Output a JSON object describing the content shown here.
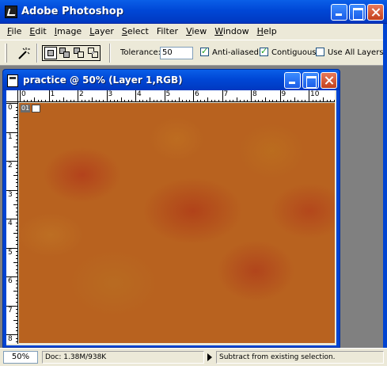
{
  "app": {
    "title": "Adobe Photoshop"
  },
  "menubar": {
    "items": [
      {
        "label_ul": "F",
        "label_rest": "ile"
      },
      {
        "label_ul": "E",
        "label_rest": "dit"
      },
      {
        "label_ul": "I",
        "label_rest": "mage"
      },
      {
        "label_ul": "L",
        "label_rest": "ayer"
      },
      {
        "label_ul": "S",
        "label_rest": "elect"
      },
      {
        "label_ul": "",
        "label_rest": "Filter"
      },
      {
        "label_ul": "V",
        "label_rest": "iew"
      },
      {
        "label_ul": "W",
        "label_rest": "indow"
      },
      {
        "label_ul": "H",
        "label_rest": "elp"
      }
    ]
  },
  "options": {
    "tool_icon": "magic-wand-icon",
    "tolerance_label": "Tolerance:",
    "tolerance_value": "50",
    "anti_aliased_label": "Anti-aliased",
    "anti_aliased_checked": true,
    "contiguous_label": "Contiguous",
    "contiguous_checked": true,
    "use_all_layers_label": "Use All Layers",
    "use_all_layers_checked": false
  },
  "document": {
    "title": "practice @ 50% (Layer 1,RGB)",
    "layer_number": "01",
    "ruler_top_labels": [
      "0",
      "1",
      "2",
      "3",
      "4",
      "5",
      "6",
      "7",
      "8",
      "9",
      "10",
      "1"
    ],
    "ruler_left_labels": [
      "0",
      "1",
      "2",
      "3",
      "4",
      "5",
      "6",
      "7",
      "8"
    ],
    "canvas_base_color": "#B8621F"
  },
  "status": {
    "zoom": "50%",
    "doc_info": "Doc: 1.38M/938K",
    "message": "Subtract from existing selection."
  },
  "colors": {
    "titlebar_blue": "#0047D6",
    "chrome": "#ECE9D8",
    "workspace": "#808080",
    "close_red": "#C4401C"
  }
}
